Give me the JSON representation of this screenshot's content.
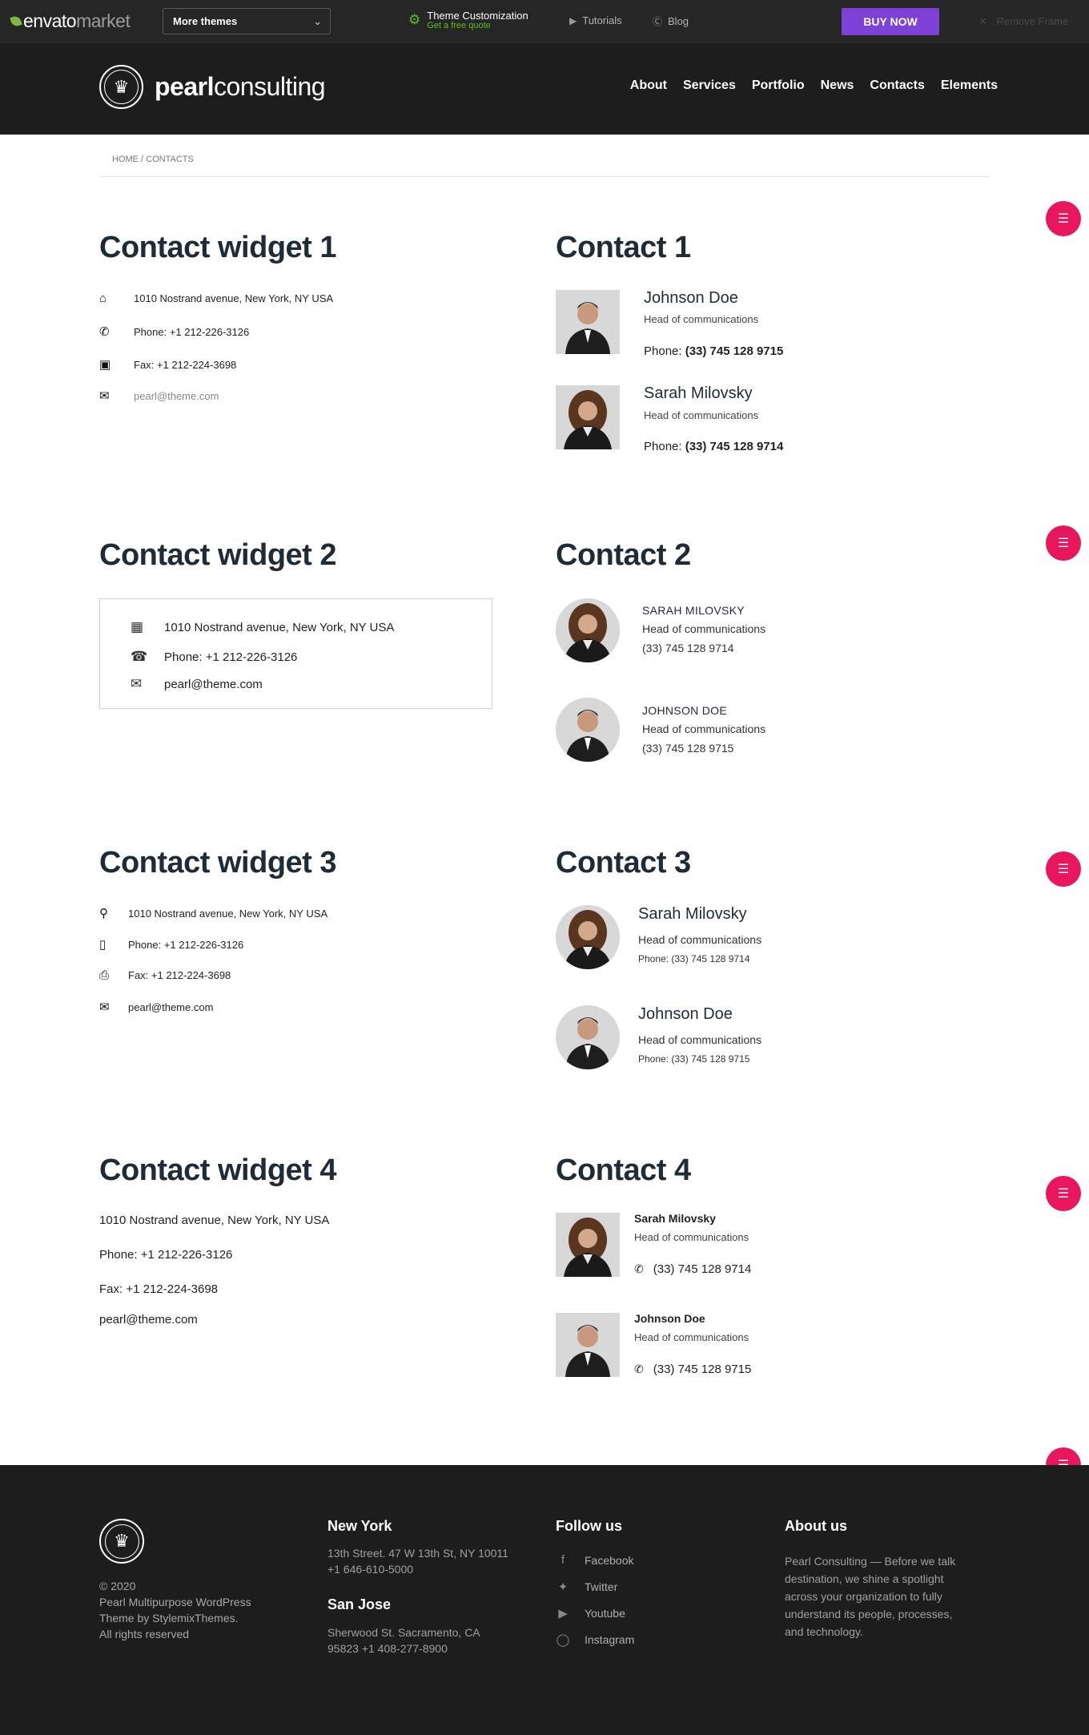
{
  "envato": {
    "logo_main": "envato",
    "logo_sub": "market",
    "themes_select": "More themes",
    "theme_custom_title": "Theme Customization",
    "theme_custom_sub": "Get a free quote",
    "tutorials": "Tutorials",
    "blog": "Blog",
    "buy_now": "BUY NOW",
    "remove_frame": "Remove Frame"
  },
  "header": {
    "brand_bold": "pearl",
    "brand_light": "consulting",
    "nav": [
      "About",
      "Services",
      "Portfolio",
      "News",
      "Contacts",
      "Elements"
    ]
  },
  "breadcrumb": "HOME / CONTACTS",
  "widget1": {
    "title": "Contact widget 1",
    "address": "1010 Nostrand avenue, New York, NY USA",
    "phone": "Phone: +1 212-226-3126",
    "fax": "Fax: +1 212-224-3698",
    "email": "pearl@theme.com"
  },
  "widget2": {
    "title": "Contact widget 2",
    "address": "1010 Nostrand avenue, New York, NY USA",
    "phone": "Phone: +1 212-226-3126",
    "email": "pearl@theme.com"
  },
  "widget3": {
    "title": "Contact widget 3",
    "address": "1010 Nostrand avenue, New York, NY USA",
    "phone": "Phone: +1 212-226-3126",
    "fax": "Fax: +1 212-224-3698",
    "email": "pearl@theme.com"
  },
  "widget4": {
    "title": "Contact widget 4",
    "address": "1010 Nostrand avenue, New York, NY USA",
    "phone": "Phone: +1 212-226-3126",
    "fax": "Fax: +1 212-224-3698",
    "email": "pearl@theme.com"
  },
  "contact1": {
    "title": "Contact 1",
    "people": [
      {
        "name": "Johnson Doe",
        "role": "Head of communications",
        "phone_label": "Phone:",
        "phone": "(33) 745 128 9715"
      },
      {
        "name": "Sarah Milovsky",
        "role": "Head of communications",
        "phone_label": "Phone:",
        "phone": "(33) 745 128 9714"
      }
    ]
  },
  "contact2": {
    "title": "Contact 2",
    "people": [
      {
        "name": "SARAH MILOVSKY",
        "role": "Head of communications",
        "phone": "(33) 745 128 9714"
      },
      {
        "name": "JOHNSON DOE",
        "role": "Head of communications",
        "phone": "(33) 745 128 9715"
      }
    ]
  },
  "contact3": {
    "title": "Contact 3",
    "people": [
      {
        "name": "Sarah Milovsky",
        "role": "Head of communications",
        "phone": "Phone: (33) 745 128 9714"
      },
      {
        "name": "Johnson Doe",
        "role": "Head of communications",
        "phone": "Phone: (33) 745 128 9715"
      }
    ]
  },
  "contact4": {
    "title": "Contact 4",
    "people": [
      {
        "name": "Sarah Milovsky",
        "role": "Head of communications",
        "phone": "(33) 745 128 9714"
      },
      {
        "name": "Johnson Doe",
        "role": "Head of communications",
        "phone": "(33) 745 128 9715"
      }
    ]
  },
  "footer": {
    "copyright": "© 2020",
    "credits": "Pearl Multipurpose WordPress Theme by StylemixThemes.",
    "rights": "All rights reserved",
    "ny_title": "New York",
    "ny_address": "13th Street. 47 W 13th St, NY 10011",
    "ny_phone": "+1 646-610-5000",
    "sj_title": "San Jose",
    "sj_address": "Sherwood St. Sacramento, CA",
    "sj_phone": "95823 +1 408-277-8900",
    "follow_title": "Follow us",
    "social": [
      "Facebook",
      "Twitter",
      "Youtube",
      "Instagram"
    ],
    "about_title": "About us",
    "about_text": "Pearl Consulting — Before we talk destination, we shine a spotlight across your organization to fully understand its people, processes, and technology."
  },
  "colors": {
    "accent_pink": "#e8175d",
    "buy_purple": "#7d41d6",
    "envato_green": "#82b541",
    "heading": "#1f2b36",
    "dark_bg": "#1d1d1d"
  },
  "icons": {
    "floating_button": "layers-icon",
    "widget1": [
      "home-icon",
      "phone-icon",
      "fax-icon",
      "envelope-icon"
    ],
    "widget2": [
      "building-icon",
      "phone-icon",
      "envelope-icon"
    ],
    "widget3": [
      "map-pin-icon",
      "mobile-icon",
      "printer-icon",
      "envelope-icon"
    ],
    "social": [
      "facebook-icon",
      "twitter-icon",
      "youtube-icon",
      "instagram-icon"
    ]
  }
}
